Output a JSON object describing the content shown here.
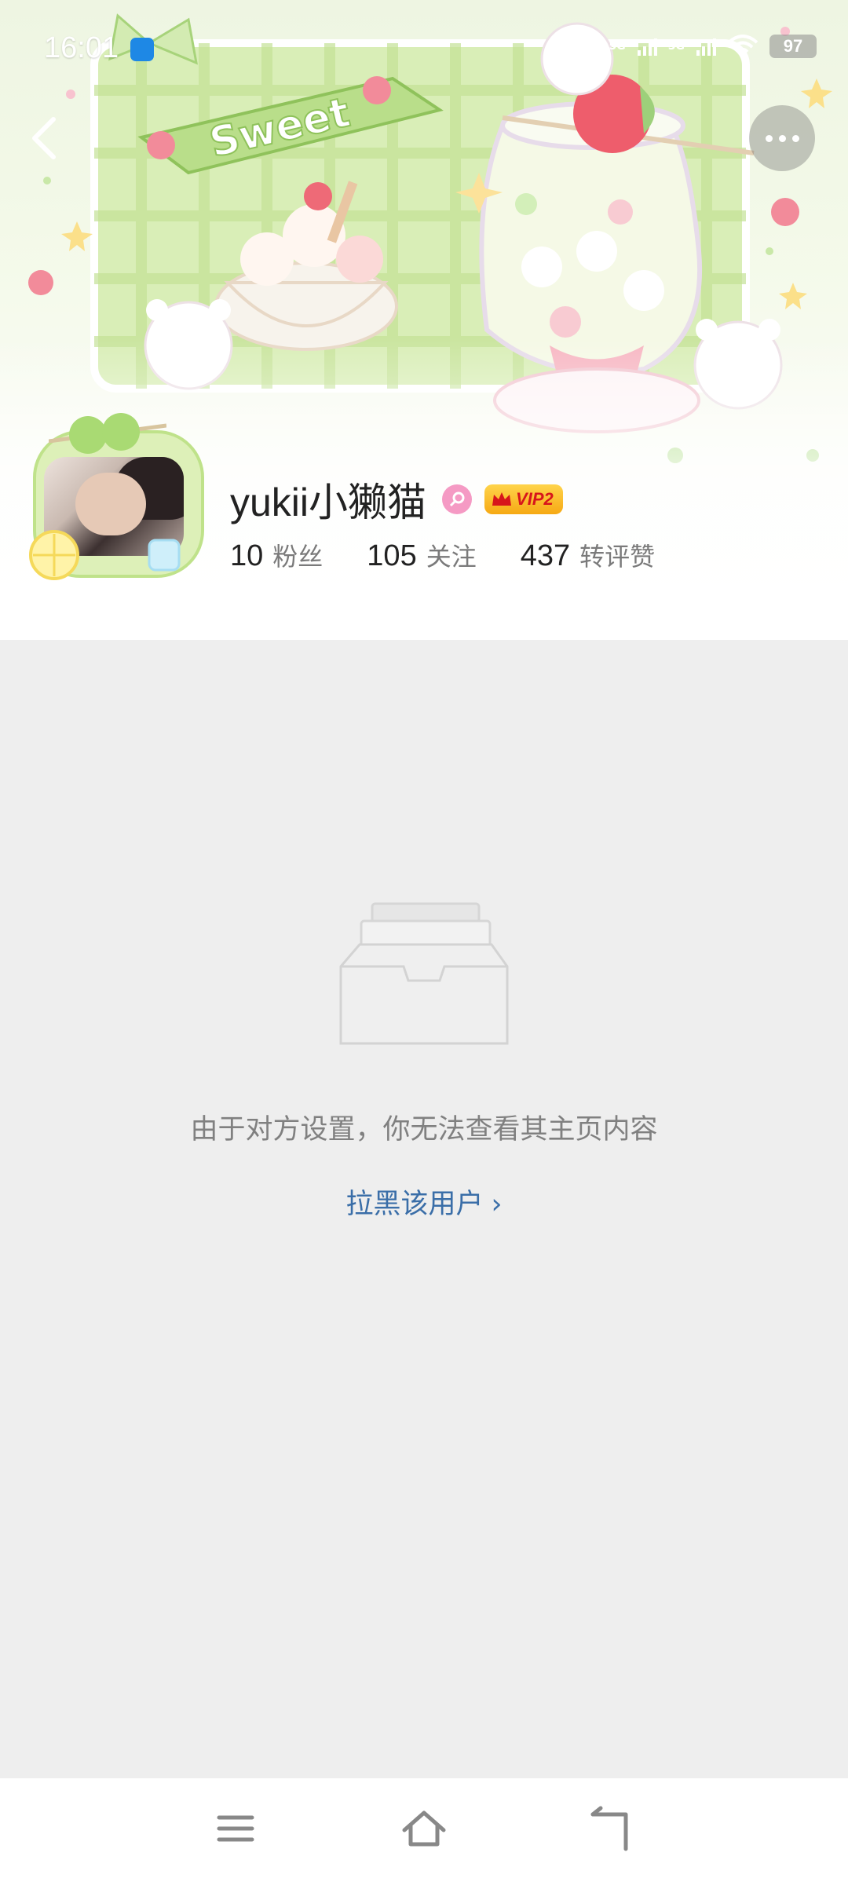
{
  "status_bar": {
    "time": "16:01",
    "signal_1": "5G",
    "signal_2": "5G",
    "battery": "97"
  },
  "banner": {
    "ribbon_text": "Sweet"
  },
  "profile": {
    "username": "yukii小獭猫",
    "vip_label": "VIP2",
    "stats": [
      {
        "num": "10",
        "label": "粉丝"
      },
      {
        "num": "105",
        "label": "关注"
      },
      {
        "num": "437",
        "label": "转评赞"
      }
    ]
  },
  "empty_state": {
    "message": "由于对方设置，你无法查看其主页内容",
    "block_link": "拉黑该用户",
    "block_link_chevron": "›"
  },
  "colors": {
    "page_bg": "#EEEEEE",
    "link": "#3A6EA8",
    "banner_green": "#D7EDB4",
    "vip_gold": "#F6A914",
    "gender_pink": "#F59AC4"
  },
  "icons": {
    "back": "back-arrow-icon",
    "more": "more-dots-icon",
    "empty": "empty-inbox-icon",
    "nav_menu": "menu-icon",
    "nav_home": "home-icon",
    "nav_back": "back-icon"
  }
}
